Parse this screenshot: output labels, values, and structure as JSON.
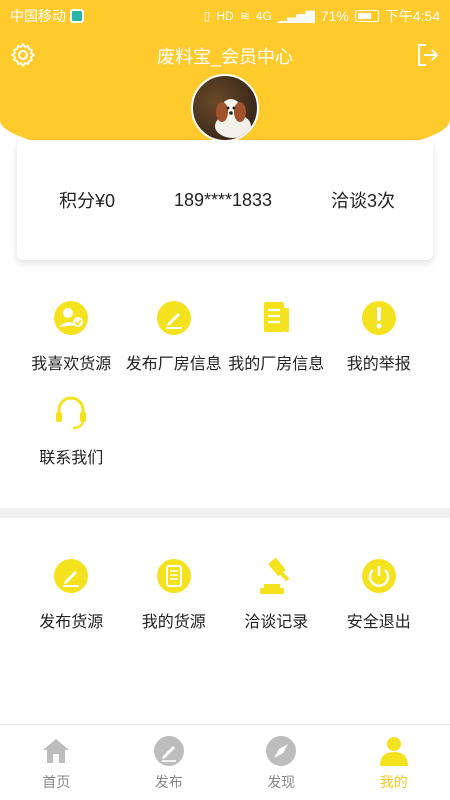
{
  "status_bar": {
    "carrier": "中国移动",
    "network": "4G",
    "battery": "71%",
    "time": "下午4:54"
  },
  "header": {
    "title": "废料宝_会员中心"
  },
  "info_card": {
    "points": "积分¥0",
    "phone": "189****1833",
    "talks": "洽谈3次"
  },
  "menu_top": [
    {
      "label": "我喜欢货源",
      "icon": "user-check-icon"
    },
    {
      "label": "发布厂房信息",
      "icon": "edit-icon"
    },
    {
      "label": "我的厂房信息",
      "icon": "document-icon"
    },
    {
      "label": "我的举报",
      "icon": "exclamation-icon"
    },
    {
      "label": "联系我们",
      "icon": "headset-icon"
    }
  ],
  "menu_bottom": [
    {
      "label": "发布货源",
      "icon": "edit-icon"
    },
    {
      "label": "我的货源",
      "icon": "list-icon"
    },
    {
      "label": "洽谈记录",
      "icon": "gavel-icon"
    },
    {
      "label": "安全退出",
      "icon": "power-icon"
    }
  ],
  "bottom_nav": [
    {
      "label": "首页",
      "icon": "home-icon",
      "active": false
    },
    {
      "label": "发布",
      "icon": "edit-icon",
      "active": false
    },
    {
      "label": "发现",
      "icon": "compass-icon",
      "active": false
    },
    {
      "label": "我的",
      "icon": "person-icon",
      "active": true
    }
  ],
  "colors": {
    "brand_yellow": "#FFCA2C",
    "icon_yellow": "#F5E21E",
    "nav_gray": "#BDBDBD",
    "nav_active": "#F5E21E"
  }
}
